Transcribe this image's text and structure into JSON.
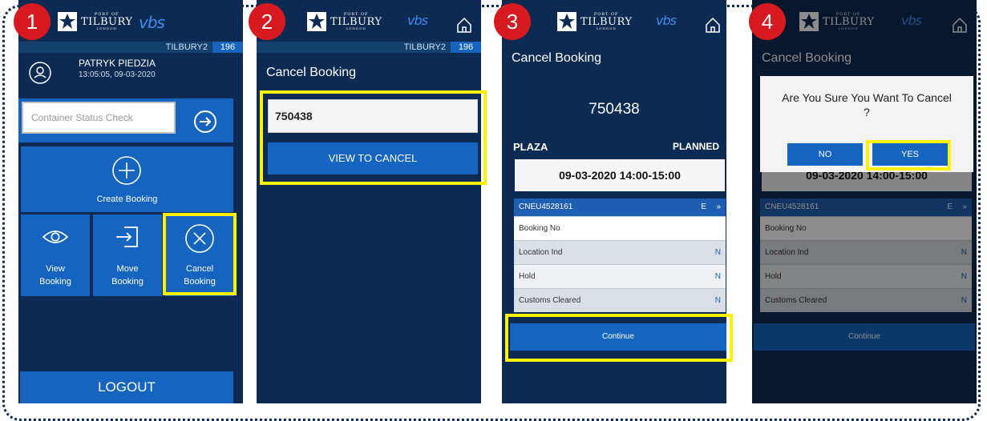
{
  "logo": {
    "t1": "PORT OF",
    "t2": "TILBURY",
    "t3": "LONDON",
    "app": "vbs"
  },
  "steps": [
    "1",
    "2",
    "3",
    "4"
  ],
  "panel1": {
    "terminal": "TILBURY2",
    "terminal_num": "196",
    "user_name": "PATRYK PIEDZIA",
    "user_time": "13:05:05, 09-03-2020",
    "container_placeholder": "Container Status Check",
    "create": "Create Booking",
    "view1": "View",
    "view2": "Booking",
    "move1": "Move",
    "move2": "Booking",
    "cancel1": "Cancel",
    "cancel2": "Booking",
    "logout": "LOGOUT"
  },
  "panel2": {
    "terminal": "TILBURY2",
    "terminal_num": "196",
    "title": "Cancel Booking",
    "input_value": "750438",
    "view_to_cancel": "VIEW TO CANCEL"
  },
  "panel3": {
    "title": "Cancel Booking",
    "booking_no": "750438",
    "location": "PLAZA",
    "status": "PLANNED",
    "slot": "09-03-2020 14:00-15:00",
    "container": "CNEU4528161",
    "type": "E",
    "rows": [
      {
        "label": "Booking No",
        "value": ""
      },
      {
        "label": "Location Ind",
        "value": "N"
      },
      {
        "label": "Hold",
        "value": "N"
      },
      {
        "label": "Customs Cleared",
        "value": "N"
      }
    ],
    "continue": "Continue"
  },
  "panel4": {
    "title_partial": "Cancel Booking",
    "question_line1": "Are You Sure You Want To Cancel",
    "question_line2": "?",
    "no": "NO",
    "yes": "YES",
    "slot_partial": "09-03-2020 14:00-15:00",
    "container": "CNEU4528161",
    "type": "E",
    "rows": [
      {
        "label": "Booking No",
        "value": ""
      },
      {
        "label": "Location Ind",
        "value": "N"
      },
      {
        "label": "Hold",
        "value": "N"
      },
      {
        "label": "Customs Cleared",
        "value": "N"
      }
    ],
    "continue": "Continue"
  },
  "colors": {
    "navy": "#0d2a52",
    "blue": "#1565c0",
    "highlight": "#fff200",
    "badge": "#d71920"
  }
}
